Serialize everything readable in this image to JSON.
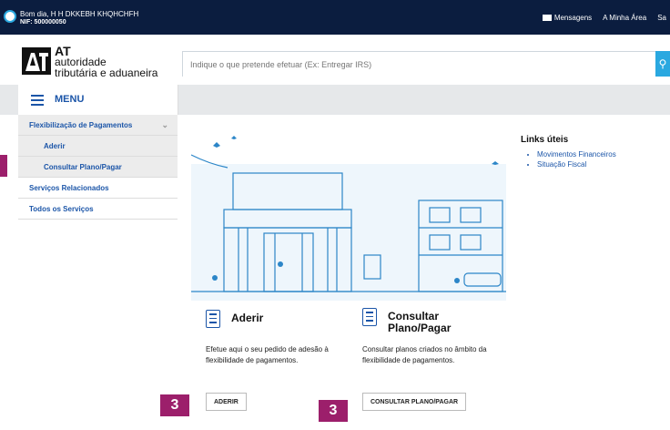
{
  "topbar": {
    "greeting": "Bom dia, H H DKKEBH KHQHCHFH",
    "nif": "NIF: 500000050",
    "messages": "Mensagens",
    "my_area": "A Minha Área",
    "exit": "Sa"
  },
  "brand": {
    "mark": "AT",
    "line1": "AT",
    "line2": "autoridade",
    "line3": "tributária e aduaneira"
  },
  "search": {
    "placeholder": "Indique o que pretende efetuar (Ex: Entregar IRS)"
  },
  "menu": {
    "title": "MENU",
    "items": [
      {
        "label": "Flexibilização de Pagamentos"
      },
      {
        "label": "Aderir"
      },
      {
        "label": "Consultar Plano/Pagar"
      },
      {
        "label": "Serviços Relacionados"
      },
      {
        "label": "Todos os Serviços"
      }
    ]
  },
  "links": {
    "title": "Links úteis",
    "items": [
      "Movimentos Financeiros",
      "Situação Fiscal"
    ]
  },
  "cards": [
    {
      "title": "Aderir",
      "description": "Efetue aqui o seu pedido de adesão à flexibilidade de pagamentos.",
      "button": "ADERIR"
    },
    {
      "title": "Consultar Plano/Pagar",
      "description": "Consultar planos criados no âmbito da flexibilidade de pagamentos.",
      "button": "CONSULTAR PLANO/PAGAR"
    }
  ],
  "badges": [
    "3",
    "3"
  ],
  "colors": {
    "topbar": "#0b1d3f",
    "accent": "#1b55a8",
    "search_button": "#2aa8e0",
    "badge": "#9c1f6b"
  }
}
